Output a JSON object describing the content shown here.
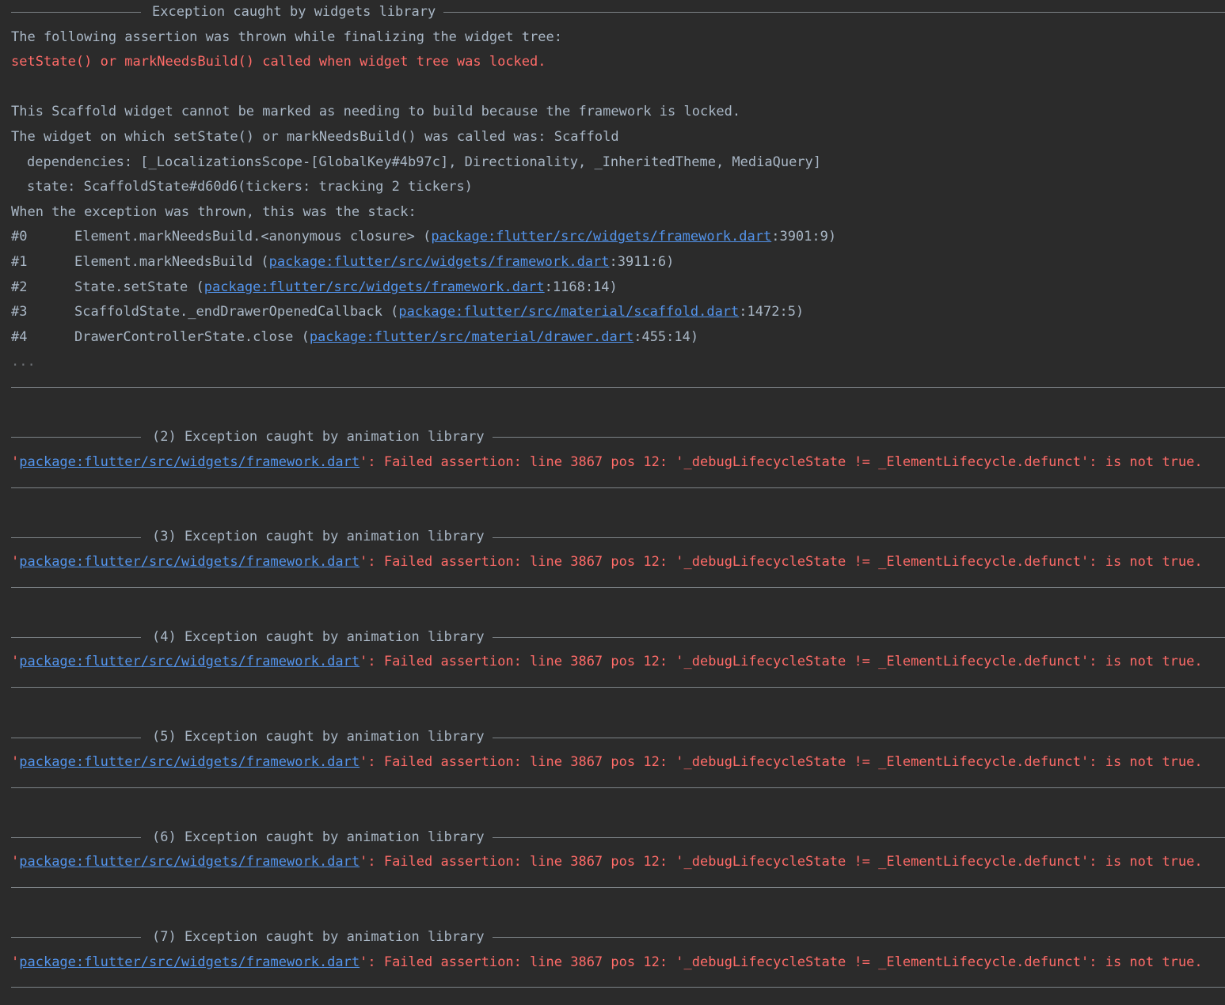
{
  "block1": {
    "header": "Exception caught by widgets library",
    "intro": "The following assertion was thrown while finalizing the widget tree:",
    "error": "setState() or markNeedsBuild() called when widget tree was locked.",
    "desc1": "This Scaffold widget cannot be marked as needing to build because the framework is locked.",
    "desc2": "The widget on which setState() or markNeedsBuild() was called was: Scaffold",
    "deps": "dependencies: [_LocalizationsScope-[GlobalKey#4b97c], Directionality, _InheritedTheme, MediaQuery]",
    "state": "state: ScaffoldState#d60d6(tickers: tracking 2 tickers)",
    "stack_intro": "When the exception was thrown, this was the stack:",
    "frames": [
      {
        "num": "#0",
        "method": "Element.markNeedsBuild.<anonymous closure> (",
        "link": "package:flutter/src/widgets/framework.dart",
        "pos": ":3901:9)"
      },
      {
        "num": "#1",
        "method": "Element.markNeedsBuild (",
        "link": "package:flutter/src/widgets/framework.dart",
        "pos": ":3911:6)"
      },
      {
        "num": "#2",
        "method": "State.setState (",
        "link": "package:flutter/src/widgets/framework.dart",
        "pos": ":1168:14)"
      },
      {
        "num": "#3",
        "method": "ScaffoldState._endDrawerOpenedCallback (",
        "link": "package:flutter/src/material/scaffold.dart",
        "pos": ":1472:5)"
      },
      {
        "num": "#4",
        "method": "DrawerControllerState.close (",
        "link": "package:flutter/src/material/drawer.dart",
        "pos": ":455:14)"
      }
    ],
    "ellipsis": "..."
  },
  "animation_blocks": [
    {
      "header": "(2) Exception caught by animation library",
      "quote_open": "'",
      "link": "package:flutter/src/widgets/framework.dart",
      "message": "': Failed assertion: line 3867 pos 12: '_debugLifecycleState != _ElementLifecycle.defunct': is not true."
    },
    {
      "header": "(3) Exception caught by animation library",
      "quote_open": "'",
      "link": "package:flutter/src/widgets/framework.dart",
      "message": "': Failed assertion: line 3867 pos 12: '_debugLifecycleState != _ElementLifecycle.defunct': is not true."
    },
    {
      "header": "(4) Exception caught by animation library",
      "quote_open": "'",
      "link": "package:flutter/src/widgets/framework.dart",
      "message": "': Failed assertion: line 3867 pos 12: '_debugLifecycleState != _ElementLifecycle.defunct': is not true."
    },
    {
      "header": "(5) Exception caught by animation library",
      "quote_open": "'",
      "link": "package:flutter/src/widgets/framework.dart",
      "message": "': Failed assertion: line 3867 pos 12: '_debugLifecycleState != _ElementLifecycle.defunct': is not true."
    },
    {
      "header": "(6) Exception caught by animation library",
      "quote_open": "'",
      "link": "package:flutter/src/widgets/framework.dart",
      "message": "': Failed assertion: line 3867 pos 12: '_debugLifecycleState != _ElementLifecycle.defunct': is not true."
    },
    {
      "header": "(7) Exception caught by animation library",
      "quote_open": "'",
      "link": "package:flutter/src/widgets/framework.dart",
      "message": "': Failed assertion: line 3867 pos 12: '_debugLifecycleState != _ElementLifecycle.defunct': is not true."
    }
  ],
  "colors": {
    "background": "#2b2b2b",
    "text": "#a9b7c6",
    "error": "#ff6b68",
    "link": "#5394ec"
  }
}
